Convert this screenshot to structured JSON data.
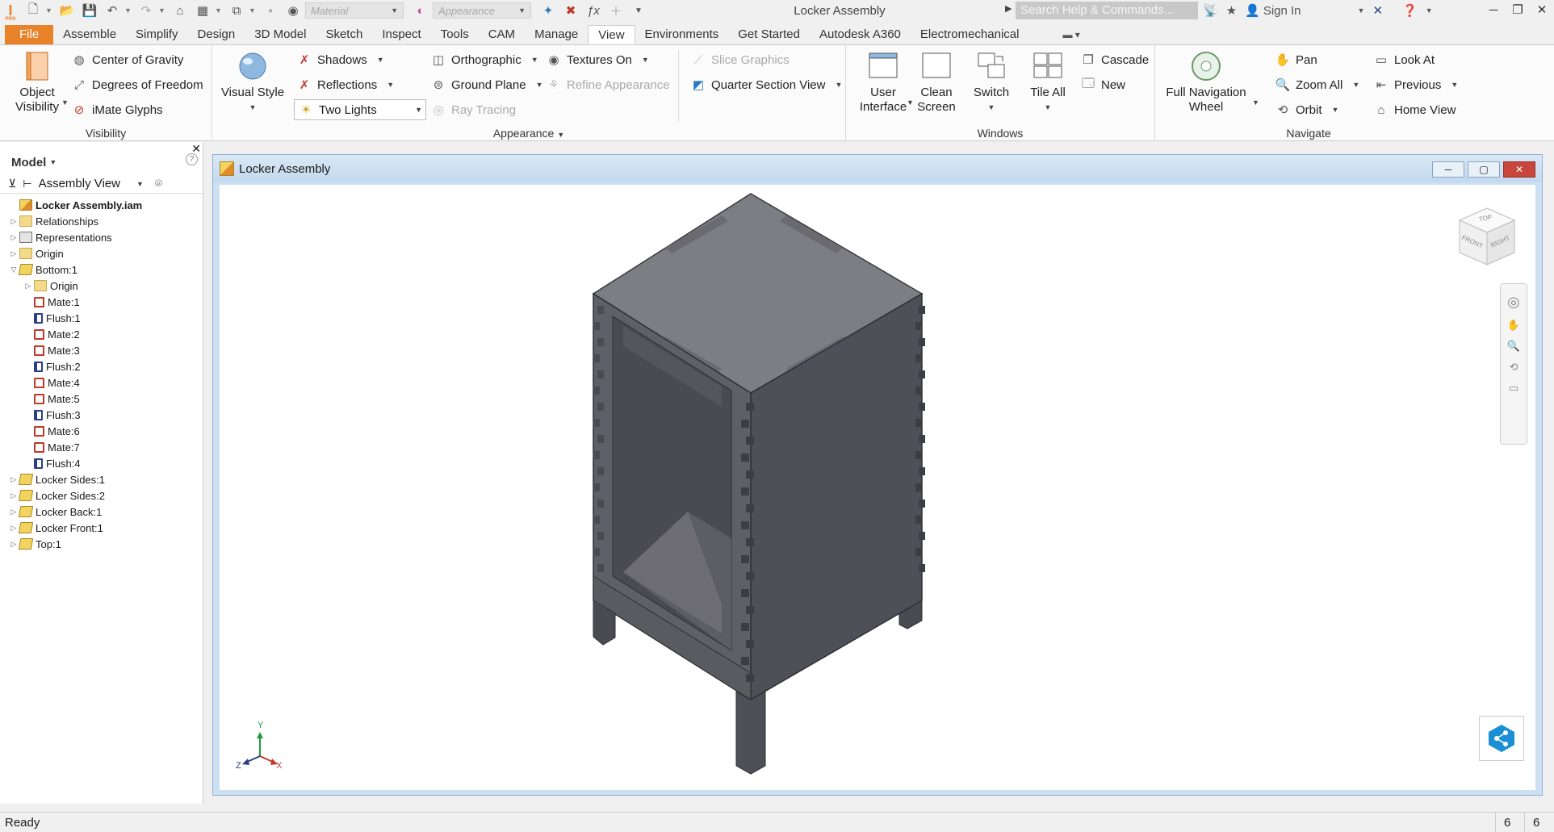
{
  "title_bar": {
    "app_title": "Locker Assembly",
    "material_placeholder": "Material",
    "appearance_placeholder": "Appearance",
    "search_placeholder": "Search Help & Commands...",
    "sign_in": "Sign In",
    "app_logo_text": "PRO"
  },
  "menu": {
    "tabs": [
      "File",
      "Assemble",
      "Simplify",
      "Design",
      "3D Model",
      "Sketch",
      "Inspect",
      "Tools",
      "CAM",
      "Manage",
      "View",
      "Environments",
      "Get Started",
      "Autodesk A360",
      "Electromechanical"
    ],
    "active": "View"
  },
  "ribbon": {
    "visibility": {
      "label": "Visibility",
      "object_visibility_line1": "Object",
      "object_visibility_line2": "Visibility",
      "center_of_gravity": "Center of Gravity",
      "degrees_of_freedom": "Degrees of Freedom",
      "imate_glyphs": "iMate Glyphs"
    },
    "appearance": {
      "label": "Appearance",
      "visual_style": "Visual Style",
      "shadows": "Shadows",
      "reflections": "Reflections",
      "lighting": "Two Lights",
      "orthographic": "Orthographic",
      "ground_plane": "Ground Plane",
      "ray_tracing": "Ray Tracing",
      "textures_on": "Textures On",
      "refine_appearance": "Refine Appearance",
      "slice_graphics": "Slice Graphics",
      "quarter_section_view": "Quarter Section View"
    },
    "windows": {
      "label": "Windows",
      "user_interface_line1": "User",
      "user_interface_line2": "Interface",
      "clean_screen_line1": "Clean",
      "clean_screen_line2": "Screen",
      "switch": "Switch",
      "tile_all": "Tile All",
      "cascade": "Cascade",
      "new": "New"
    },
    "navigate": {
      "label": "Navigate",
      "full_nav_line1": "Full Navigation",
      "full_nav_line2": "Wheel",
      "pan": "Pan",
      "zoom_all": "Zoom All",
      "orbit": "Orbit",
      "look_at": "Look At",
      "previous": "Previous",
      "home_view": "Home View"
    }
  },
  "browser": {
    "header": "Model",
    "view_mode": "Assembly View",
    "tree": [
      {
        "label": "Locker Assembly.iam",
        "icon": "assembly",
        "level": 0,
        "toggle": "",
        "bold": true
      },
      {
        "label": "Relationships",
        "icon": "folder",
        "level": 0,
        "toggle": ">"
      },
      {
        "label": "Representations",
        "icon": "representations",
        "level": 0,
        "toggle": ">"
      },
      {
        "label": "Origin",
        "icon": "folder",
        "level": 0,
        "toggle": ">"
      },
      {
        "label": "Bottom:1",
        "icon": "part-active",
        "level": 0,
        "toggle": "v"
      },
      {
        "label": "Origin",
        "icon": "folder",
        "level": 1,
        "toggle": ">"
      },
      {
        "label": "Mate:1",
        "icon": "mate",
        "level": 1,
        "toggle": ""
      },
      {
        "label": "Flush:1",
        "icon": "flush",
        "level": 1,
        "toggle": ""
      },
      {
        "label": "Mate:2",
        "icon": "mate",
        "level": 1,
        "toggle": ""
      },
      {
        "label": "Mate:3",
        "icon": "mate",
        "level": 1,
        "toggle": ""
      },
      {
        "label": "Flush:2",
        "icon": "flush",
        "level": 1,
        "toggle": ""
      },
      {
        "label": "Mate:4",
        "icon": "mate",
        "level": 1,
        "toggle": ""
      },
      {
        "label": "Mate:5",
        "icon": "mate",
        "level": 1,
        "toggle": ""
      },
      {
        "label": "Flush:3",
        "icon": "flush",
        "level": 1,
        "toggle": ""
      },
      {
        "label": "Mate:6",
        "icon": "mate",
        "level": 1,
        "toggle": ""
      },
      {
        "label": "Mate:7",
        "icon": "mate",
        "level": 1,
        "toggle": ""
      },
      {
        "label": "Flush:4",
        "icon": "flush",
        "level": 1,
        "toggle": ""
      },
      {
        "label": "Locker Sides:1",
        "icon": "part",
        "level": 0,
        "toggle": ">"
      },
      {
        "label": "Locker Sides:2",
        "icon": "part",
        "level": 0,
        "toggle": ">"
      },
      {
        "label": "Locker Back:1",
        "icon": "part",
        "level": 0,
        "toggle": ">"
      },
      {
        "label": "Locker Front:1",
        "icon": "part",
        "level": 0,
        "toggle": ">"
      },
      {
        "label": "Top:1",
        "icon": "part",
        "level": 0,
        "toggle": ">"
      }
    ]
  },
  "document": {
    "title": "Locker Assembly",
    "viewcube": {
      "top": "TOP",
      "front": "FRONT",
      "right": "RIGHT"
    },
    "axes": {
      "x": "X",
      "y": "Y",
      "z": "Z"
    }
  },
  "status": {
    "text": "Ready",
    "count_a": "6",
    "count_b": "6"
  },
  "colors": {
    "file_tab": "#e8832a",
    "model_top": "#7b7b82",
    "model_dark": "#4f5057",
    "model_mid": "#5f6067",
    "close_button": "#c9463d",
    "viewport_frame": "#cde0f2"
  }
}
